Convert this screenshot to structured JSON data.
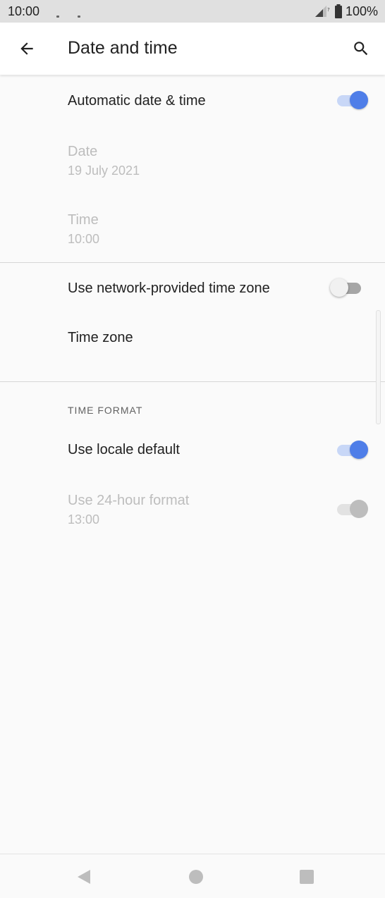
{
  "status_bar": {
    "time": "10:00",
    "battery_percent": "100%"
  },
  "app_bar": {
    "title": "Date and time",
    "back_icon": "arrow-left-icon",
    "search_icon": "search-icon"
  },
  "settings": {
    "automatic_date_time": {
      "title": "Automatic date & time",
      "enabled": true
    },
    "date": {
      "title": "Date",
      "summary": "19 July 2021"
    },
    "time": {
      "title": "Time",
      "summary": "10:00"
    },
    "network_time_zone": {
      "title": "Use network-provided time zone",
      "enabled": false
    },
    "time_zone": {
      "title": "Time zone"
    },
    "time_format_header": "TIME FORMAT",
    "locale_default": {
      "title": "Use locale default",
      "enabled": true
    },
    "hour24": {
      "title": "Use 24-hour format",
      "summary": "13:00",
      "enabled": true,
      "disabled": true
    }
  },
  "colors": {
    "accent": "#4f7ee8",
    "disabled_text": "#bdbdbd",
    "background": "#fafafa"
  }
}
